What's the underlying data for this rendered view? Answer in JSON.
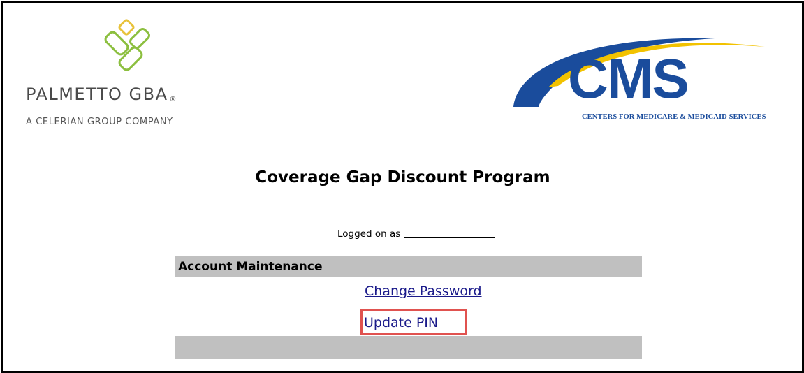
{
  "palmetto": {
    "name": "PALMETTO GBA",
    "registered": "®",
    "tagline": "A CELERIAN GROUP COMPANY"
  },
  "cms": {
    "letters": "CMS",
    "subtitle": "CENTERS FOR MEDICARE & MEDICAID SERVICES"
  },
  "page": {
    "title": "Coverage Gap Discount Program",
    "logged_on_label": "Logged on as"
  },
  "account": {
    "header": "Account Maintenance",
    "links": {
      "change_password": "Change Password",
      "update_pin": "Update PIN"
    }
  },
  "colors": {
    "cms_blue": "#1a4c9c",
    "cms_yellow": "#f2c200",
    "palmetto_green": "#8cbf3f",
    "palmetto_gold": "#e8c23a",
    "highlight_red": "#e0524f",
    "table_gray": "#c0c0c0",
    "link": "#1a1a8a"
  }
}
